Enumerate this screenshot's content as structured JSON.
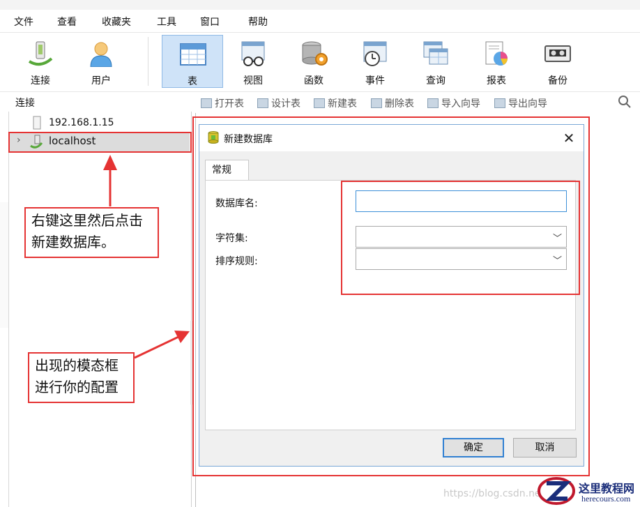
{
  "menu": [
    "文件",
    "查看",
    "收藏夹",
    "工具",
    "窗口",
    "帮助"
  ],
  "toolbar": {
    "buttons": [
      {
        "label": "连接",
        "icon": "connection-plug-icon"
      },
      {
        "label": "用户",
        "icon": "user-icon"
      },
      {
        "label": "表",
        "icon": "table-icon",
        "active": true
      },
      {
        "label": "视图",
        "icon": "view-glasses-icon"
      },
      {
        "label": "函数",
        "icon": "function-gear-icon"
      },
      {
        "label": "事件",
        "icon": "event-clock-icon"
      },
      {
        "label": "查询",
        "icon": "query-grid-icon"
      },
      {
        "label": "报表",
        "icon": "report-chart-icon"
      },
      {
        "label": "备份",
        "icon": "backup-tape-icon"
      }
    ]
  },
  "subtoolbar": {
    "connection_label": "连接",
    "items": [
      "打开表",
      "设计表",
      "新建表",
      "删除表",
      "导入向导",
      "导出向导"
    ]
  },
  "tree": {
    "server_ip": "192.168.1.15",
    "localhost": "localhost"
  },
  "dialog": {
    "title": "新建数据库",
    "tab": "常规",
    "labels": {
      "dbname": "数据库名:",
      "charset": "字符集:",
      "collation": "排序规则:"
    },
    "dbname_value": "",
    "ok": "确定",
    "cancel": "取消"
  },
  "annotations": {
    "note1": "右键这里然后点击新建数据库。",
    "note2": "出现的模态框进行你的配置"
  },
  "watermark": {
    "url": "https://blog.csdn.ne",
    "title": "这里教程网",
    "sub": "herecours.com"
  },
  "colors": {
    "annotation_red": "#e53333",
    "active_tab": "#cfe3f8",
    "input_focus": "#3c8fd8"
  }
}
